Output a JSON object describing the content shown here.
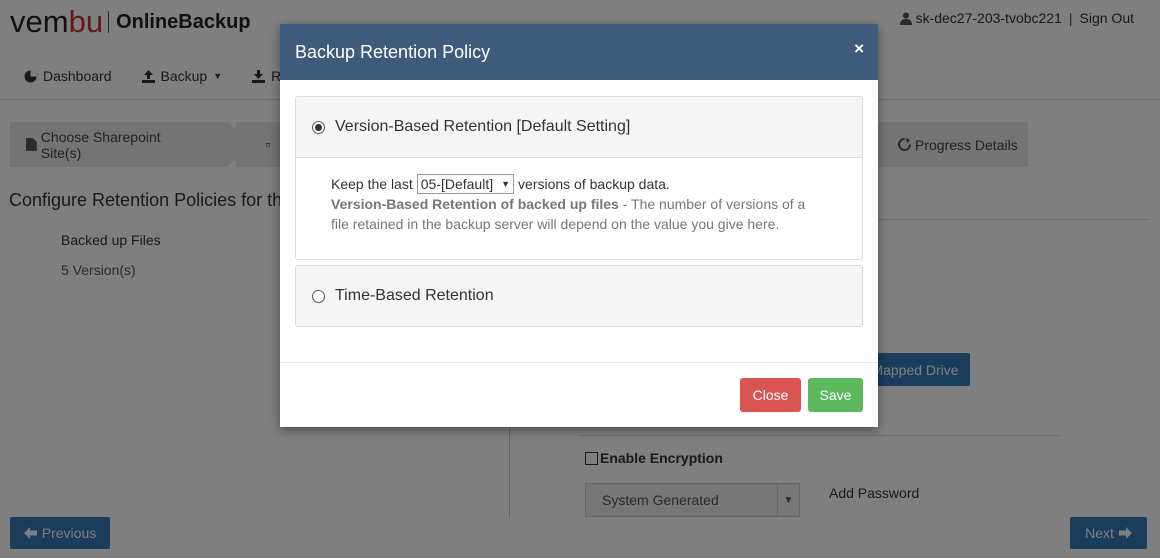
{
  "header": {
    "logo_text_1": "vem",
    "logo_text_accent": "bu",
    "product": "OnlineBackup",
    "user": "sk-dec27-203-tvobc221",
    "sign_out": "Sign Out",
    "nav": {
      "dashboard": "Dashboard",
      "backup": "Backup",
      "restore_partial": "R"
    }
  },
  "wizard": {
    "step1": "Choose Sharepoint Site(s)",
    "progress": "Progress Details"
  },
  "main": {
    "section_title": "Configure Retention Policies for th",
    "backed_label": "Backed up Files",
    "backed_value": "5  Version(s)",
    "mapped_drive": "Mapped Drive",
    "enable_encryption": "Enable Encryption",
    "system_generated": "System Generated",
    "add_password": "Add Password",
    "previous": "Previous",
    "next": "Next"
  },
  "modal": {
    "title": "Backup Retention Policy",
    "close_x": "×",
    "version_option": "Version-Based Retention [Default Setting]",
    "keep_last": "Keep the last",
    "versions_selected": "05-[Default]",
    "versions_suffix": "versions of backup data.",
    "desc_bold": "Version-Based Retention of backed up files",
    "desc_text": " - The number of versions of a file retained in the backup server will depend on the value you give here.",
    "time_option": "Time-Based Retention",
    "close_button": "Close",
    "save_button": "Save"
  }
}
